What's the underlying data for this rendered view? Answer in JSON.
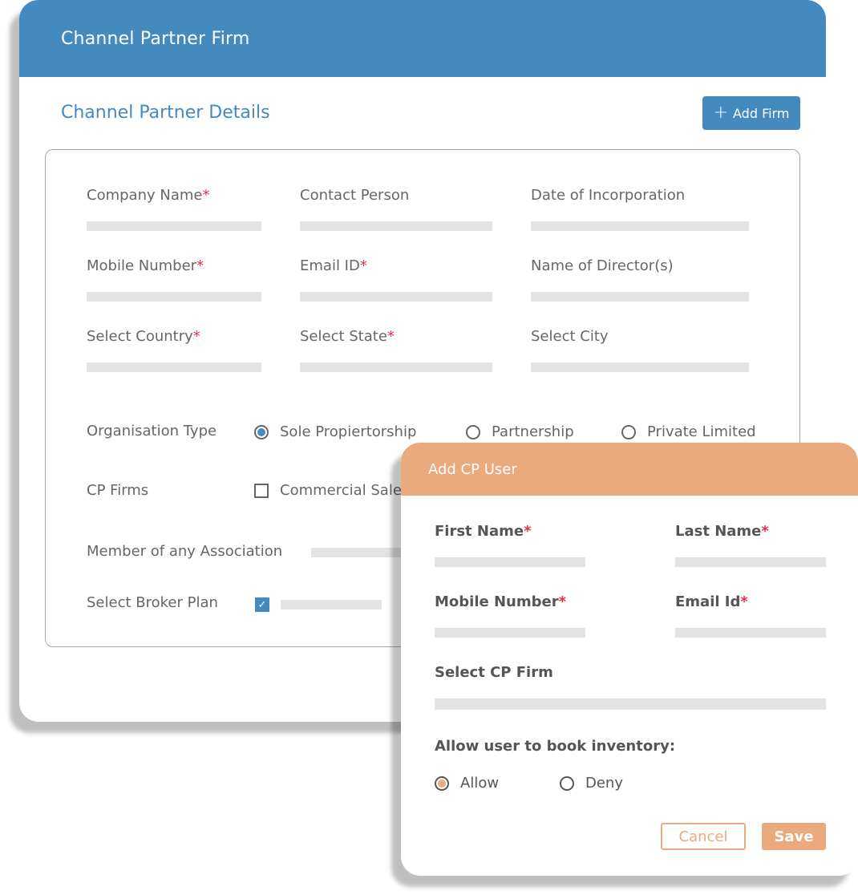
{
  "colors": {
    "primary": "#448abe",
    "accent": "#eba97e",
    "required": "#e0304a",
    "input_bg": "#e3e3e3"
  },
  "main": {
    "title": "Channel Partner Firm",
    "section_title": "Channel Partner Details",
    "add_firm_label": "Add Firm",
    "add_firm_icon": "plus-icon",
    "fields": [
      {
        "label": "Company Name",
        "required": true
      },
      {
        "label": "Contact Person",
        "required": false
      },
      {
        "label": "Date of Incorporation",
        "required": false
      },
      {
        "label": "Mobile Number",
        "required": true
      },
      {
        "label": "Email ID",
        "required": true
      },
      {
        "label": "Name of Director(s)",
        "required": false
      },
      {
        "label": "Select Country",
        "required": true
      },
      {
        "label": "Select State",
        "required": true
      },
      {
        "label": "Select City",
        "required": false
      }
    ],
    "required_mark": "*",
    "organisation_type": {
      "label": "Organisation Type",
      "options": [
        "Sole Propiertorship",
        "Partnership",
        "Private Limited"
      ],
      "selected": "Sole Propiertorship"
    },
    "cp_firms": {
      "label": "CP Firms",
      "options": [
        {
          "label": "Commercial Sale",
          "checked": false
        }
      ]
    },
    "member_association": {
      "label": "Member of any Association"
    },
    "broker_plan": {
      "label": "Select Broker Plan",
      "checked": true,
      "check_glyph": "✓"
    }
  },
  "popup": {
    "title": "Add CP User",
    "fields": [
      {
        "label": "First Name",
        "required": true
      },
      {
        "label": "Last Name",
        "required": true
      },
      {
        "label": "Mobile Number",
        "required": true
      },
      {
        "label": "Email Id",
        "required": true
      },
      {
        "label": "Select CP Firm",
        "required": false
      }
    ],
    "inventory": {
      "label": "Allow user to book inventory:",
      "options": [
        "Allow",
        "Deny"
      ],
      "selected": "Allow"
    },
    "cancel_label": "Cancel",
    "save_label": "Save"
  }
}
